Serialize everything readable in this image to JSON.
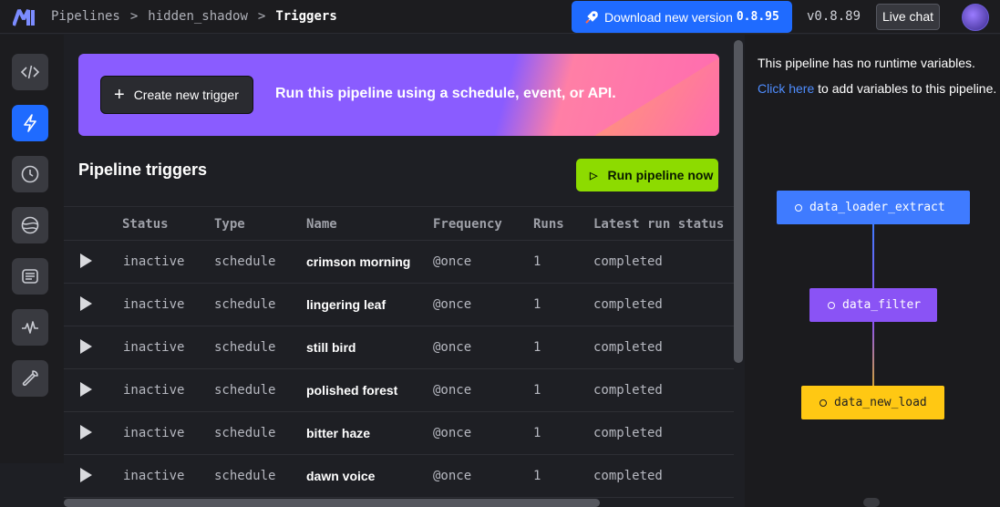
{
  "header": {
    "breadcrumbs": [
      "Pipelines",
      "hidden_shadow",
      "Triggers"
    ],
    "separator": ">",
    "download_label": "Download new version",
    "download_version": "0.8.95",
    "current_version": "v0.8.89",
    "live_chat_label": "Live chat"
  },
  "nav": {
    "items": [
      {
        "icon": "code-icon",
        "active": false
      },
      {
        "icon": "lightning-icon",
        "active": true
      },
      {
        "icon": "clock-icon",
        "active": false
      },
      {
        "icon": "globe-icon",
        "active": false
      },
      {
        "icon": "terminal-icon",
        "active": false
      },
      {
        "icon": "pulse-icon",
        "active": false
      },
      {
        "icon": "wrench-icon",
        "active": false
      }
    ]
  },
  "banner": {
    "create_label": "Create new trigger",
    "tagline": "Run this pipeline using a schedule, event, or API."
  },
  "triggers": {
    "title": "Pipeline triggers",
    "run_now_label": "Run pipeline now",
    "columns": [
      "Status",
      "Type",
      "Name",
      "Frequency",
      "Runs",
      "Latest run status"
    ],
    "rows": [
      {
        "status": "inactive",
        "type": "schedule",
        "name": "crimson morning",
        "frequency": "@once",
        "runs": "1",
        "latest": "completed"
      },
      {
        "status": "inactive",
        "type": "schedule",
        "name": "lingering leaf",
        "frequency": "@once",
        "runs": "1",
        "latest": "completed"
      },
      {
        "status": "inactive",
        "type": "schedule",
        "name": "still bird",
        "frequency": "@once",
        "runs": "1",
        "latest": "completed"
      },
      {
        "status": "inactive",
        "type": "schedule",
        "name": "polished forest",
        "frequency": "@once",
        "runs": "1",
        "latest": "completed"
      },
      {
        "status": "inactive",
        "type": "schedule",
        "name": "bitter haze",
        "frequency": "@once",
        "runs": "1",
        "latest": "completed"
      },
      {
        "status": "inactive",
        "type": "schedule",
        "name": "dawn voice",
        "frequency": "@once",
        "runs": "1",
        "latest": "completed"
      }
    ]
  },
  "variables": {
    "message": "This pipeline has no runtime variables.",
    "link_text": "Click here",
    "link_suffix": " to add variables to this pipeline."
  },
  "graph": {
    "nodes": [
      {
        "name": "data_loader_extract",
        "color": "#3f7bff"
      },
      {
        "name": "data_filter",
        "color": "#8a53f5"
      },
      {
        "name": "data_new_load",
        "color": "#ffc813"
      }
    ]
  },
  "colors": {
    "accent": "#1f6bff",
    "run_button": "#8ddb00"
  }
}
